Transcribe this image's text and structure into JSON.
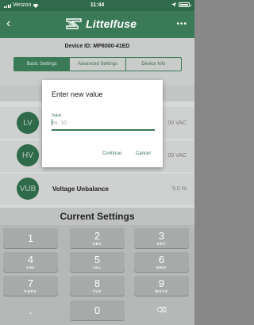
{
  "status_bar": {
    "carrier": "Verizon",
    "time": "11:44"
  },
  "nav": {
    "brand": "Littelfuse",
    "more": "•••"
  },
  "device": {
    "id_label": "Device ID: MP8000-41ED"
  },
  "tabs": [
    {
      "label": "Basic Settings"
    },
    {
      "label": "Advanced Settings"
    },
    {
      "label": "Device Info"
    }
  ],
  "rows": [
    {
      "badge": "LV",
      "label": "",
      "value": "00 VAC"
    },
    {
      "badge": "HV",
      "label": "",
      "value": "00 VAC"
    },
    {
      "badge": "VUB",
      "label": "Voltage Unbalance",
      "value": "5.0 %"
    }
  ],
  "current_settings": {
    "title": "Current Settings"
  },
  "dialog": {
    "title": "Enter new value",
    "field_label": "Value",
    "placeholder": "ex. 10",
    "continue_label": "Continue",
    "cancel_label": "Cancel"
  },
  "keyboard": {
    "keys": [
      {
        "num": "1",
        "letters": ""
      },
      {
        "num": "2",
        "letters": "ABC"
      },
      {
        "num": "3",
        "letters": "DEF"
      },
      {
        "num": "4",
        "letters": "GHI"
      },
      {
        "num": "5",
        "letters": "JKL"
      },
      {
        "num": "6",
        "letters": "MNO"
      },
      {
        "num": "7",
        "letters": "PQRS"
      },
      {
        "num": "8",
        "letters": "TUV"
      },
      {
        "num": "9",
        "letters": "WXYZ"
      },
      {
        "num": ".",
        "letters": ""
      },
      {
        "num": "0",
        "letters": ""
      },
      {
        "num": "⌫",
        "letters": ""
      }
    ]
  },
  "colors": {
    "brand_green": "#3b7a57",
    "dark_green": "#2f6a4a"
  }
}
